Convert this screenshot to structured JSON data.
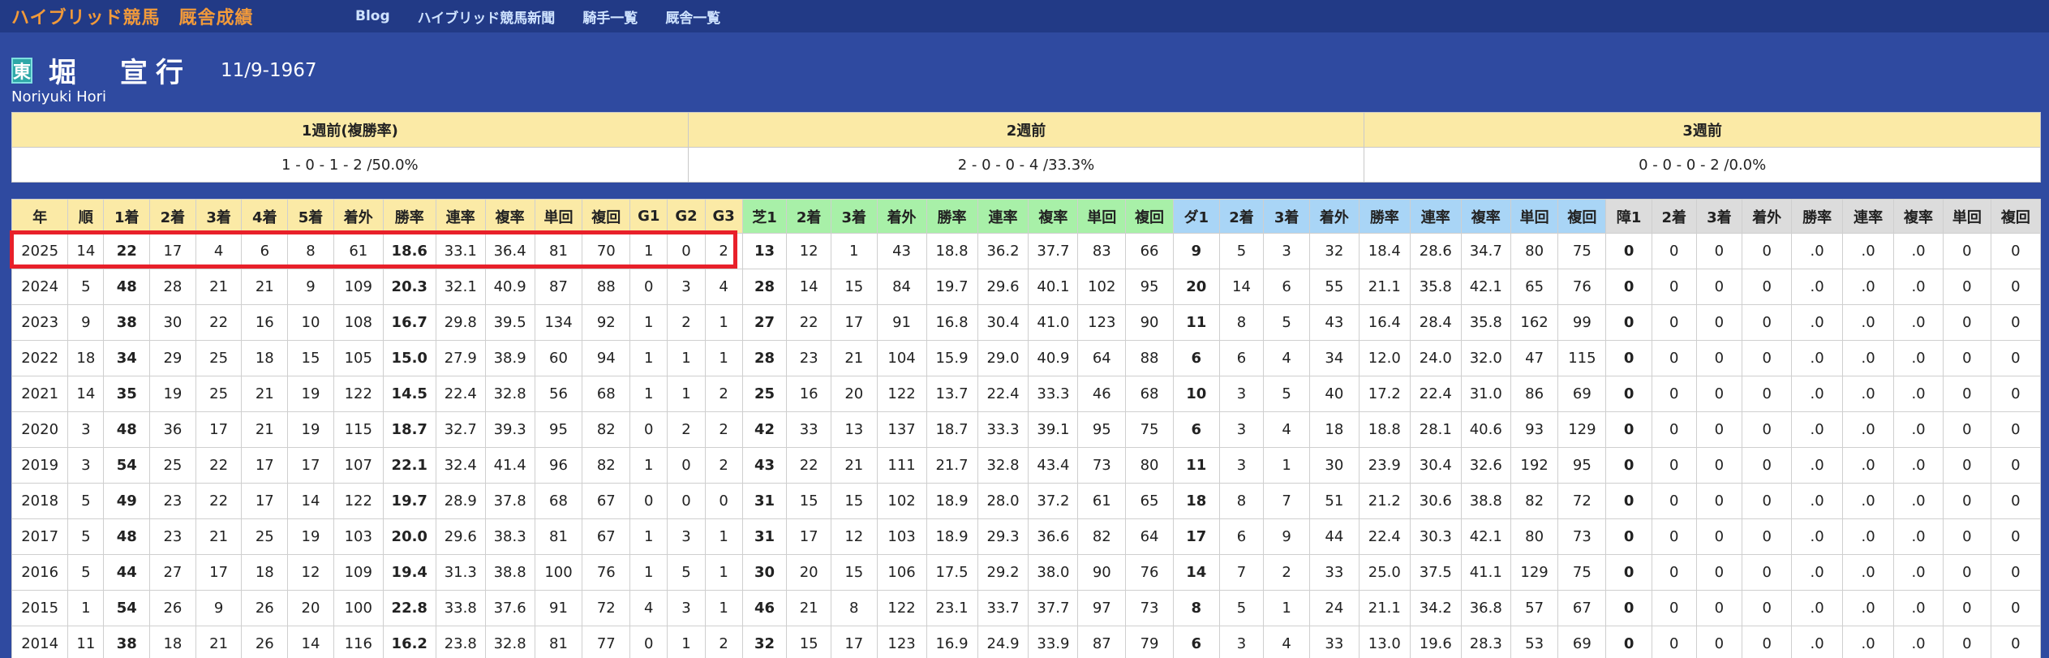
{
  "site": {
    "brand": "ハイブリッド競馬　厩舎成績",
    "nav": [
      "Blog",
      "ハイブリッド競馬新聞",
      "騎手一覧",
      "厩舎一覧"
    ]
  },
  "jockey": {
    "region": "東",
    "name": "堀　宣行",
    "birth": "11/9-1967",
    "romaji": "Noriyuki Hori"
  },
  "weekly": {
    "headers": [
      "1週前(複勝率)",
      "2週前",
      "3週前"
    ],
    "values": [
      "1 - 0 - 1 - 2 /50.0%",
      "2 - 0 - 0 - 4 /33.3%",
      "0 - 0 - 0 - 2 /0.0%"
    ]
  },
  "stats": {
    "headers": [
      "年",
      "順",
      "1着",
      "2着",
      "3着",
      "4着",
      "5着",
      "着外",
      "勝率",
      "連率",
      "複率",
      "単回",
      "複回",
      "G1",
      "G2",
      "G3",
      "芝1",
      "2着",
      "3着",
      "着外",
      "勝率",
      "連率",
      "複率",
      "単回",
      "複回",
      "ダ1",
      "2着",
      "3着",
      "着外",
      "勝率",
      "連率",
      "複率",
      "単回",
      "複回",
      "障1",
      "2着",
      "3着",
      "着外",
      "勝率",
      "連率",
      "複率",
      "単回",
      "複回"
    ],
    "highlight_year": "2025",
    "rows": [
      [
        "2025",
        "14",
        "22",
        "17",
        "4",
        "6",
        "8",
        "61",
        "18.6",
        "33.1",
        "36.4",
        "81",
        "70",
        "1",
        "0",
        "2",
        "13",
        "12",
        "1",
        "43",
        "18.8",
        "36.2",
        "37.7",
        "83",
        "66",
        "9",
        "5",
        "3",
        "32",
        "18.4",
        "28.6",
        "34.7",
        "80",
        "75",
        "0",
        "0",
        "0",
        "0",
        ".0",
        ".0",
        ".0",
        "0",
        "0"
      ],
      [
        "2024",
        "5",
        "48",
        "28",
        "21",
        "21",
        "9",
        "109",
        "20.3",
        "32.1",
        "40.9",
        "87",
        "88",
        "0",
        "3",
        "4",
        "28",
        "14",
        "15",
        "84",
        "19.7",
        "29.6",
        "40.1",
        "102",
        "95",
        "20",
        "14",
        "6",
        "55",
        "21.1",
        "35.8",
        "42.1",
        "65",
        "76",
        "0",
        "0",
        "0",
        "0",
        ".0",
        ".0",
        ".0",
        "0",
        "0"
      ],
      [
        "2023",
        "9",
        "38",
        "30",
        "22",
        "16",
        "10",
        "108",
        "16.7",
        "29.8",
        "39.5",
        "134",
        "92",
        "1",
        "2",
        "1",
        "27",
        "22",
        "17",
        "91",
        "16.8",
        "30.4",
        "41.0",
        "123",
        "90",
        "11",
        "8",
        "5",
        "43",
        "16.4",
        "28.4",
        "35.8",
        "162",
        "99",
        "0",
        "0",
        "0",
        "0",
        ".0",
        ".0",
        ".0",
        "0",
        "0"
      ],
      [
        "2022",
        "18",
        "34",
        "29",
        "25",
        "18",
        "15",
        "105",
        "15.0",
        "27.9",
        "38.9",
        "60",
        "94",
        "1",
        "1",
        "1",
        "28",
        "23",
        "21",
        "104",
        "15.9",
        "29.0",
        "40.9",
        "64",
        "88",
        "6",
        "6",
        "4",
        "34",
        "12.0",
        "24.0",
        "32.0",
        "47",
        "115",
        "0",
        "0",
        "0",
        "0",
        ".0",
        ".0",
        ".0",
        "0",
        "0"
      ],
      [
        "2021",
        "14",
        "35",
        "19",
        "25",
        "21",
        "19",
        "122",
        "14.5",
        "22.4",
        "32.8",
        "56",
        "68",
        "1",
        "1",
        "2",
        "25",
        "16",
        "20",
        "122",
        "13.7",
        "22.4",
        "33.3",
        "46",
        "68",
        "10",
        "3",
        "5",
        "40",
        "17.2",
        "22.4",
        "31.0",
        "86",
        "69",
        "0",
        "0",
        "0",
        "0",
        ".0",
        ".0",
        ".0",
        "0",
        "0"
      ],
      [
        "2020",
        "3",
        "48",
        "36",
        "17",
        "21",
        "19",
        "115",
        "18.7",
        "32.7",
        "39.3",
        "95",
        "82",
        "0",
        "2",
        "2",
        "42",
        "33",
        "13",
        "137",
        "18.7",
        "33.3",
        "39.1",
        "95",
        "75",
        "6",
        "3",
        "4",
        "18",
        "18.8",
        "28.1",
        "40.6",
        "93",
        "129",
        "0",
        "0",
        "0",
        "0",
        ".0",
        ".0",
        ".0",
        "0",
        "0"
      ],
      [
        "2019",
        "3",
        "54",
        "25",
        "22",
        "17",
        "17",
        "107",
        "22.1",
        "32.4",
        "41.4",
        "96",
        "82",
        "1",
        "0",
        "2",
        "43",
        "22",
        "21",
        "111",
        "21.7",
        "32.8",
        "43.4",
        "73",
        "80",
        "11",
        "3",
        "1",
        "30",
        "23.9",
        "30.4",
        "32.6",
        "192",
        "95",
        "0",
        "0",
        "0",
        "0",
        ".0",
        ".0",
        ".0",
        "0",
        "0"
      ],
      [
        "2018",
        "5",
        "49",
        "23",
        "22",
        "17",
        "14",
        "122",
        "19.7",
        "28.9",
        "37.8",
        "68",
        "67",
        "0",
        "0",
        "0",
        "31",
        "15",
        "15",
        "102",
        "18.9",
        "28.0",
        "37.2",
        "61",
        "65",
        "18",
        "8",
        "7",
        "51",
        "21.2",
        "30.6",
        "38.8",
        "82",
        "72",
        "0",
        "0",
        "0",
        "0",
        ".0",
        ".0",
        ".0",
        "0",
        "0"
      ],
      [
        "2017",
        "5",
        "48",
        "23",
        "21",
        "25",
        "19",
        "103",
        "20.0",
        "29.6",
        "38.3",
        "81",
        "67",
        "1",
        "3",
        "1",
        "31",
        "17",
        "12",
        "103",
        "18.9",
        "29.3",
        "36.6",
        "82",
        "64",
        "17",
        "6",
        "9",
        "44",
        "22.4",
        "30.3",
        "42.1",
        "80",
        "73",
        "0",
        "0",
        "0",
        "0",
        ".0",
        ".0",
        ".0",
        "0",
        "0"
      ],
      [
        "2016",
        "5",
        "44",
        "27",
        "17",
        "18",
        "12",
        "109",
        "19.4",
        "31.3",
        "38.8",
        "100",
        "76",
        "1",
        "5",
        "1",
        "30",
        "20",
        "15",
        "106",
        "17.5",
        "29.2",
        "38.0",
        "90",
        "76",
        "14",
        "7",
        "2",
        "33",
        "25.0",
        "37.5",
        "41.1",
        "129",
        "75",
        "0",
        "0",
        "0",
        "0",
        ".0",
        ".0",
        ".0",
        "0",
        "0"
      ],
      [
        "2015",
        "1",
        "54",
        "26",
        "9",
        "26",
        "20",
        "100",
        "22.8",
        "33.8",
        "37.6",
        "91",
        "72",
        "4",
        "3",
        "1",
        "46",
        "21",
        "8",
        "122",
        "23.1",
        "33.7",
        "37.7",
        "97",
        "73",
        "8",
        "5",
        "1",
        "24",
        "21.1",
        "34.2",
        "36.8",
        "57",
        "67",
        "0",
        "0",
        "0",
        "0",
        ".0",
        ".0",
        ".0",
        "0",
        "0"
      ],
      [
        "2014",
        "11",
        "38",
        "18",
        "21",
        "26",
        "14",
        "116",
        "16.2",
        "23.8",
        "32.8",
        "81",
        "77",
        "0",
        "1",
        "2",
        "32",
        "15",
        "17",
        "123",
        "16.9",
        "24.9",
        "33.9",
        "87",
        "79",
        "6",
        "3",
        "4",
        "33",
        "13.0",
        "19.6",
        "28.3",
        "53",
        "69",
        "0",
        "0",
        "0",
        "0",
        ".0",
        ".0",
        ".0",
        "0",
        "0"
      ]
    ]
  }
}
